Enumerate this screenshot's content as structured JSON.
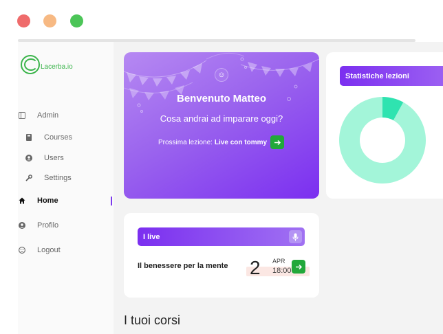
{
  "window": {
    "controls": [
      "close",
      "minimize",
      "maximize"
    ]
  },
  "brand": {
    "name": "Lacerba.io",
    "color": "#3ab44a"
  },
  "sidebar": {
    "items": [
      {
        "label": "Admin",
        "icon": "admin-panel-icon"
      },
      {
        "label": "Courses",
        "icon": "book-icon"
      },
      {
        "label": "Users",
        "icon": "user-circle-icon"
      },
      {
        "label": "Settings",
        "icon": "wrench-icon"
      },
      {
        "label": "Home",
        "icon": "home-icon",
        "active": true
      },
      {
        "label": "Profilo",
        "icon": "profile-icon"
      },
      {
        "label": "Logout",
        "icon": "logout-icon"
      }
    ]
  },
  "welcome": {
    "title": "Benvenuto Matteo",
    "subtitle": "Cosa andrai ad imparare oggi?",
    "next_prefix": "Prossima lezione:",
    "next_lesson": "Live con tommy"
  },
  "stats": {
    "title": "Statistiche lezioni",
    "colors": {
      "main": "#a3f5d9",
      "accent": "#2fe3b0"
    },
    "chart_data": {
      "type": "pie",
      "values": [
        92,
        8
      ]
    }
  },
  "live": {
    "title": "I live",
    "event": {
      "name": "Il benessere per la mente",
      "day": "2",
      "month": "APR",
      "time": "18:00"
    }
  },
  "courses": {
    "title": "I tuoi corsi"
  },
  "colors": {
    "accent": "#7b2ff0",
    "button_green": "#22a83a"
  }
}
